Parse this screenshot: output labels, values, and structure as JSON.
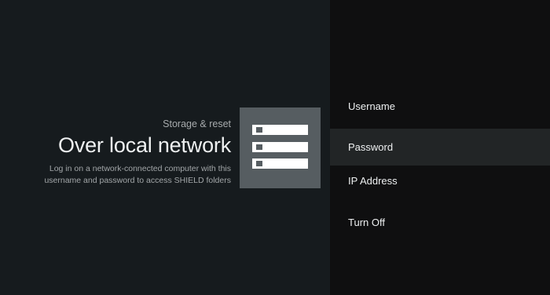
{
  "header": {
    "breadcrumb": "Storage & reset",
    "title": "Over local network",
    "description": "Log in on a network-connected computer with this username and password to access SHIELD folders"
  },
  "icon": {
    "name": "storage-server-icon",
    "background": "#565d61",
    "foreground": "#ffffff"
  },
  "menu": {
    "items": [
      {
        "label": "Username",
        "selected": false
      },
      {
        "label": "Password",
        "selected": true
      },
      {
        "label": "IP Address",
        "selected": false
      },
      {
        "label": "Turn Off",
        "selected": false
      }
    ]
  },
  "colors": {
    "left_background": "#161b1e",
    "right_background": "#0f0f10",
    "selected_item": "#222526",
    "primary_text": "#eef0f1",
    "secondary_text": "#a7abad"
  }
}
